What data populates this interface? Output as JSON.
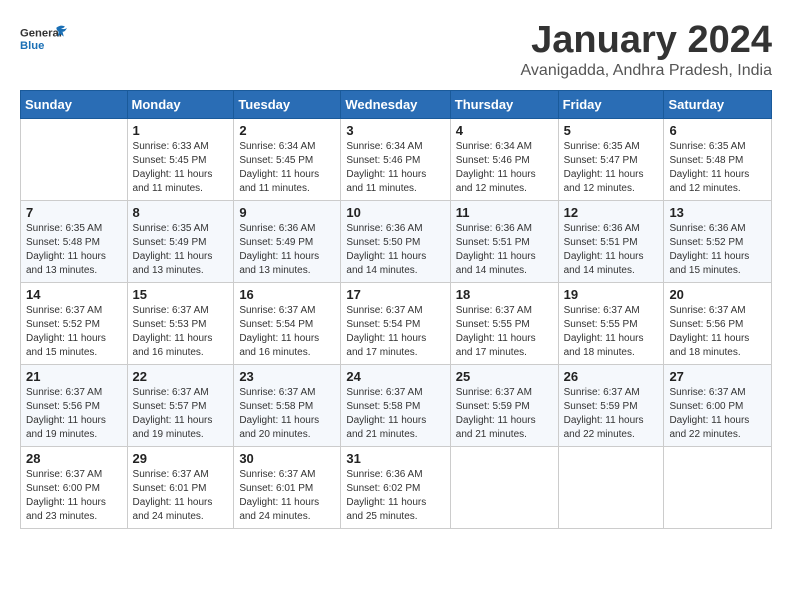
{
  "header": {
    "logo": {
      "line1": "General",
      "line2": "Blue"
    },
    "title": "January 2024",
    "location": "Avanigadda, Andhra Pradesh, India"
  },
  "weekdays": [
    "Sunday",
    "Monday",
    "Tuesday",
    "Wednesday",
    "Thursday",
    "Friday",
    "Saturday"
  ],
  "weeks": [
    [
      {
        "day": "",
        "info": ""
      },
      {
        "day": "1",
        "info": "Sunrise: 6:33 AM\nSunset: 5:45 PM\nDaylight: 11 hours\nand 11 minutes."
      },
      {
        "day": "2",
        "info": "Sunrise: 6:34 AM\nSunset: 5:45 PM\nDaylight: 11 hours\nand 11 minutes."
      },
      {
        "day": "3",
        "info": "Sunrise: 6:34 AM\nSunset: 5:46 PM\nDaylight: 11 hours\nand 11 minutes."
      },
      {
        "day": "4",
        "info": "Sunrise: 6:34 AM\nSunset: 5:46 PM\nDaylight: 11 hours\nand 12 minutes."
      },
      {
        "day": "5",
        "info": "Sunrise: 6:35 AM\nSunset: 5:47 PM\nDaylight: 11 hours\nand 12 minutes."
      },
      {
        "day": "6",
        "info": "Sunrise: 6:35 AM\nSunset: 5:48 PM\nDaylight: 11 hours\nand 12 minutes."
      }
    ],
    [
      {
        "day": "7",
        "info": "Sunrise: 6:35 AM\nSunset: 5:48 PM\nDaylight: 11 hours\nand 13 minutes."
      },
      {
        "day": "8",
        "info": "Sunrise: 6:35 AM\nSunset: 5:49 PM\nDaylight: 11 hours\nand 13 minutes."
      },
      {
        "day": "9",
        "info": "Sunrise: 6:36 AM\nSunset: 5:49 PM\nDaylight: 11 hours\nand 13 minutes."
      },
      {
        "day": "10",
        "info": "Sunrise: 6:36 AM\nSunset: 5:50 PM\nDaylight: 11 hours\nand 14 minutes."
      },
      {
        "day": "11",
        "info": "Sunrise: 6:36 AM\nSunset: 5:51 PM\nDaylight: 11 hours\nand 14 minutes."
      },
      {
        "day": "12",
        "info": "Sunrise: 6:36 AM\nSunset: 5:51 PM\nDaylight: 11 hours\nand 14 minutes."
      },
      {
        "day": "13",
        "info": "Sunrise: 6:36 AM\nSunset: 5:52 PM\nDaylight: 11 hours\nand 15 minutes."
      }
    ],
    [
      {
        "day": "14",
        "info": "Sunrise: 6:37 AM\nSunset: 5:52 PM\nDaylight: 11 hours\nand 15 minutes."
      },
      {
        "day": "15",
        "info": "Sunrise: 6:37 AM\nSunset: 5:53 PM\nDaylight: 11 hours\nand 16 minutes."
      },
      {
        "day": "16",
        "info": "Sunrise: 6:37 AM\nSunset: 5:54 PM\nDaylight: 11 hours\nand 16 minutes."
      },
      {
        "day": "17",
        "info": "Sunrise: 6:37 AM\nSunset: 5:54 PM\nDaylight: 11 hours\nand 17 minutes."
      },
      {
        "day": "18",
        "info": "Sunrise: 6:37 AM\nSunset: 5:55 PM\nDaylight: 11 hours\nand 17 minutes."
      },
      {
        "day": "19",
        "info": "Sunrise: 6:37 AM\nSunset: 5:55 PM\nDaylight: 11 hours\nand 18 minutes."
      },
      {
        "day": "20",
        "info": "Sunrise: 6:37 AM\nSunset: 5:56 PM\nDaylight: 11 hours\nand 18 minutes."
      }
    ],
    [
      {
        "day": "21",
        "info": "Sunrise: 6:37 AM\nSunset: 5:56 PM\nDaylight: 11 hours\nand 19 minutes."
      },
      {
        "day": "22",
        "info": "Sunrise: 6:37 AM\nSunset: 5:57 PM\nDaylight: 11 hours\nand 19 minutes."
      },
      {
        "day": "23",
        "info": "Sunrise: 6:37 AM\nSunset: 5:58 PM\nDaylight: 11 hours\nand 20 minutes."
      },
      {
        "day": "24",
        "info": "Sunrise: 6:37 AM\nSunset: 5:58 PM\nDaylight: 11 hours\nand 21 minutes."
      },
      {
        "day": "25",
        "info": "Sunrise: 6:37 AM\nSunset: 5:59 PM\nDaylight: 11 hours\nand 21 minutes."
      },
      {
        "day": "26",
        "info": "Sunrise: 6:37 AM\nSunset: 5:59 PM\nDaylight: 11 hours\nand 22 minutes."
      },
      {
        "day": "27",
        "info": "Sunrise: 6:37 AM\nSunset: 6:00 PM\nDaylight: 11 hours\nand 22 minutes."
      }
    ],
    [
      {
        "day": "28",
        "info": "Sunrise: 6:37 AM\nSunset: 6:00 PM\nDaylight: 11 hours\nand 23 minutes."
      },
      {
        "day": "29",
        "info": "Sunrise: 6:37 AM\nSunset: 6:01 PM\nDaylight: 11 hours\nand 24 minutes."
      },
      {
        "day": "30",
        "info": "Sunrise: 6:37 AM\nSunset: 6:01 PM\nDaylight: 11 hours\nand 24 minutes."
      },
      {
        "day": "31",
        "info": "Sunrise: 6:36 AM\nSunset: 6:02 PM\nDaylight: 11 hours\nand 25 minutes."
      },
      {
        "day": "",
        "info": ""
      },
      {
        "day": "",
        "info": ""
      },
      {
        "day": "",
        "info": ""
      }
    ]
  ]
}
